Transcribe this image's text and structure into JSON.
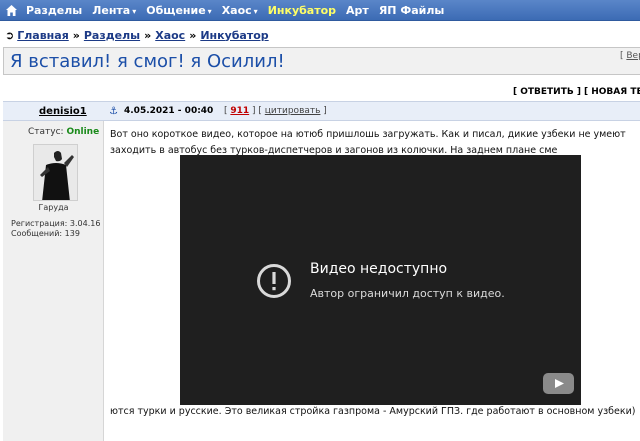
{
  "nav": {
    "items": [
      {
        "label": "Разделы",
        "caret": false
      },
      {
        "label": "Лента",
        "caret": true
      },
      {
        "label": "Общение",
        "caret": true
      },
      {
        "label": "Хаос",
        "caret": true
      },
      {
        "label": "Инкубатор",
        "caret": false,
        "highlight": true
      },
      {
        "label": "Арт",
        "caret": false
      },
      {
        "label": "ЯП Файлы",
        "caret": false
      }
    ],
    "caret_glyph": "▾",
    "highlight_color": "#ffff66"
  },
  "breadcrumb": {
    "arrow": "➲",
    "items": [
      "Главная",
      "Разделы",
      "Хаос",
      "Инкубатор"
    ],
    "sep": "»"
  },
  "topic": {
    "title": "Я вставил! я смог! я Осилил!",
    "right_link_prefix": "[ ",
    "right_link": "Вер"
  },
  "actions": {
    "reply": "[ ОТВЕТИТЬ ]",
    "new_topic": "[ НОВАЯ ТЕМ"
  },
  "post": {
    "author": "denisio1",
    "anchor": "⚓",
    "date": "4.05.2021 - 00:40",
    "num_prefix": "[ ",
    "num": "911",
    "num_suffix": " ]  [ ",
    "quote": "цитировать",
    "quote_suffix": " ]",
    "text_line1": "Вот оно короткое видео, которое на ютюб пришлошь загружать. Как и писал, дикие узбеки не умеют",
    "text_line2": "заходить в автобус без турков-диспетчеров и загонов из колючки. На заднем плане сме",
    "text_line3": "ются турки и русские. Это великая стройка газпрома - Амурский ГПЗ. где работают в основном узбеки)"
  },
  "user": {
    "status_label": "Статус: ",
    "status_value": "Online",
    "status_color": "#1a8a1a",
    "avatar_caption": "Гаруда",
    "reg_label": "Регистрация: 3.04.16",
    "msgs_label": "Сообщений: 139"
  },
  "video": {
    "error_title": "Видео недоступно",
    "error_subtitle": "Автор ограничил доступ к видео.",
    "icons": [
      "error-icon",
      "youtube-icon"
    ]
  },
  "colors": {
    "nav_bg": "#4a78c0",
    "link": "#1c3a86",
    "title": "#1c4fa8",
    "video_bg": "#1f1f1f"
  }
}
